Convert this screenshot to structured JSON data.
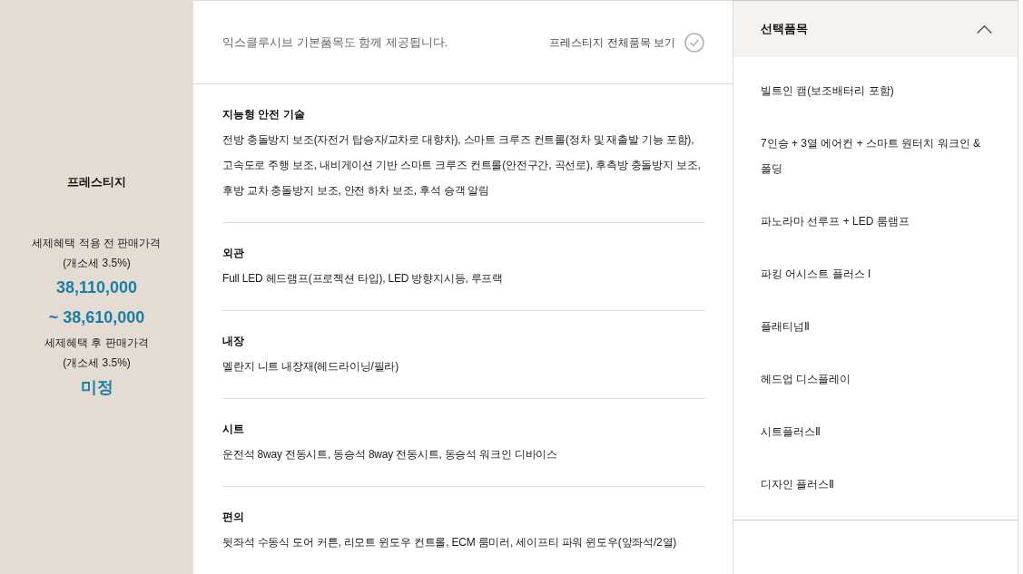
{
  "trim": {
    "name": "프레스티지",
    "prices": [
      {
        "label": "세제혜택 적용 전 판매가격",
        "note": "(개소세 3.5%)",
        "values": [
          "38,110,000",
          "~ 38,610,000"
        ]
      },
      {
        "label": "세제혜택 후 판매가격",
        "note": "(개소세 3.5%)",
        "values": [
          "미정"
        ]
      }
    ]
  },
  "basic_items": {
    "notice": "익스클루시브 기본품목도 함께 제공됩니다.",
    "view_all": {
      "label": "프레스티지 전체품목 보기",
      "checked": false
    },
    "sections": [
      {
        "title": "지능형 안전 기술",
        "text": "전방 충돌방지 보조(자전거 탑승자/교차로 대향차), 스마트 크루즈 컨트롤(정차 및 재출발 기능 포함), 고속도로 주행 보조, 내비게이션 기반 스마트 크루즈 컨트롤(안전구간, 곡선로), 후측방 충돌방지 보조, 후방 교차 충돌방지 보조, 안전 하차 보조, 후석 승객 알림"
      },
      {
        "title": "외관",
        "text": "Full LED 헤드램프(프로젝션 타입), LED 방향지시등, 루프랙"
      },
      {
        "title": "내장",
        "text": "멜란지 니트 내장재(헤드라이닝/필라)"
      },
      {
        "title": "시트",
        "text": "운전석 8way 전동시트, 동승석 8way 전동시트, 동승석 워크인 디바이스"
      },
      {
        "title": "편의",
        "text": "뒷좌석 수동식 도어 커튼, 리모트 윈도우 컨트롤, ECM 룸미러, 세이프티 파워 윈도우(앞좌석/2열)"
      }
    ]
  },
  "options": {
    "title": "선택품목",
    "expanded": true,
    "items": [
      "빌트인 캠(보조배터리 포함)",
      "7인승 + 3열 에어컨 + 스마트 원터치 워크인 & 폴딩",
      "파노라마 선루프 + LED 룸램프",
      "파킹 어시스트 플러스 I",
      "플래티넘Ⅱ",
      "헤드업 디스플레이",
      "시트플러스Ⅱ",
      "디자인 플러스Ⅱ"
    ]
  }
}
